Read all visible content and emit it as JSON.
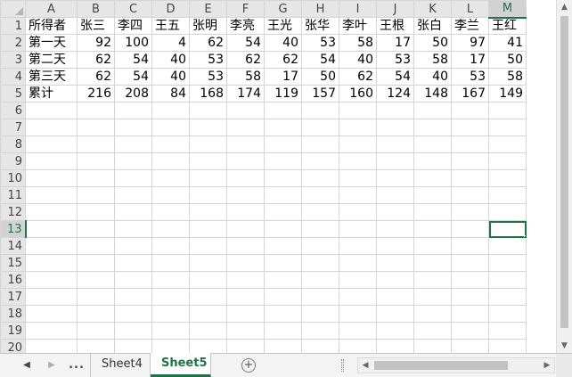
{
  "spreadsheet": {
    "columns": [
      "A",
      "B",
      "C",
      "D",
      "E",
      "F",
      "G",
      "H",
      "I",
      "J",
      "K",
      "L",
      "M"
    ],
    "active_column": "M",
    "active_row": "13",
    "rows": [
      {
        "n": "1",
        "cells": [
          "所得者",
          "张三",
          "李四",
          "王五",
          "张明",
          "李亮",
          "王光",
          "张华",
          "李叶",
          "王根",
          "张白",
          "李兰",
          "王红"
        ]
      },
      {
        "n": "2",
        "cells": [
          "第一天",
          "92",
          "100",
          "4",
          "62",
          "54",
          "40",
          "53",
          "58",
          "17",
          "50",
          "97",
          "41"
        ]
      },
      {
        "n": "3",
        "cells": [
          "第二天",
          "62",
          "54",
          "40",
          "53",
          "62",
          "62",
          "54",
          "40",
          "53",
          "58",
          "17",
          "50"
        ]
      },
      {
        "n": "4",
        "cells": [
          "第三天",
          "62",
          "54",
          "40",
          "53",
          "58",
          "17",
          "50",
          "62",
          "54",
          "40",
          "53",
          "58"
        ]
      },
      {
        "n": "5",
        "cells": [
          "累计",
          "216",
          "208",
          "84",
          "168",
          "174",
          "119",
          "157",
          "160",
          "124",
          "148",
          "167",
          "149"
        ]
      },
      {
        "n": "6",
        "cells": [
          "",
          "",
          "",
          "",
          "",
          "",
          "",
          "",
          "",
          "",
          "",
          "",
          ""
        ]
      },
      {
        "n": "7",
        "cells": [
          "",
          "",
          "",
          "",
          "",
          "",
          "",
          "",
          "",
          "",
          "",
          "",
          ""
        ]
      },
      {
        "n": "8",
        "cells": [
          "",
          "",
          "",
          "",
          "",
          "",
          "",
          "",
          "",
          "",
          "",
          "",
          ""
        ]
      },
      {
        "n": "9",
        "cells": [
          "",
          "",
          "",
          "",
          "",
          "",
          "",
          "",
          "",
          "",
          "",
          "",
          ""
        ]
      },
      {
        "n": "10",
        "cells": [
          "",
          "",
          "",
          "",
          "",
          "",
          "",
          "",
          "",
          "",
          "",
          "",
          ""
        ]
      },
      {
        "n": "11",
        "cells": [
          "",
          "",
          "",
          "",
          "",
          "",
          "",
          "",
          "",
          "",
          "",
          "",
          ""
        ]
      },
      {
        "n": "12",
        "cells": [
          "",
          "",
          "",
          "",
          "",
          "",
          "",
          "",
          "",
          "",
          "",
          "",
          ""
        ]
      },
      {
        "n": "13",
        "cells": [
          "",
          "",
          "",
          "",
          "",
          "",
          "",
          "",
          "",
          "",
          "",
          "",
          ""
        ]
      },
      {
        "n": "14",
        "cells": [
          "",
          "",
          "",
          "",
          "",
          "",
          "",
          "",
          "",
          "",
          "",
          "",
          ""
        ]
      },
      {
        "n": "15",
        "cells": [
          "",
          "",
          "",
          "",
          "",
          "",
          "",
          "",
          "",
          "",
          "",
          "",
          ""
        ]
      },
      {
        "n": "16",
        "cells": [
          "",
          "",
          "",
          "",
          "",
          "",
          "",
          "",
          "",
          "",
          "",
          "",
          ""
        ]
      },
      {
        "n": "17",
        "cells": [
          "",
          "",
          "",
          "",
          "",
          "",
          "",
          "",
          "",
          "",
          "",
          "",
          ""
        ]
      },
      {
        "n": "18",
        "cells": [
          "",
          "",
          "",
          "",
          "",
          "",
          "",
          "",
          "",
          "",
          "",
          "",
          ""
        ]
      },
      {
        "n": "19",
        "cells": [
          "",
          "",
          "",
          "",
          "",
          "",
          "",
          "",
          "",
          "",
          "",
          "",
          ""
        ]
      },
      {
        "n": "20",
        "cells": [
          "",
          "",
          "",
          "",
          "",
          "",
          "",
          "",
          "",
          "",
          "",
          "",
          ""
        ]
      }
    ]
  },
  "tabs": {
    "more_label": "...",
    "items": [
      {
        "label": "Sheet4",
        "active": false
      },
      {
        "label": "Sheet5",
        "active": true
      }
    ],
    "add_label": "+"
  },
  "icons": {
    "prev": "triangle-left-icon",
    "next": "triangle-right-icon",
    "add": "plus-circle-icon",
    "scroll_up": "triangle-up-icon",
    "scroll_down": "triangle-down-icon"
  },
  "colors": {
    "accent": "#217346",
    "header_bg": "#e6e6e6",
    "grid_line": "#d4d4d4"
  }
}
